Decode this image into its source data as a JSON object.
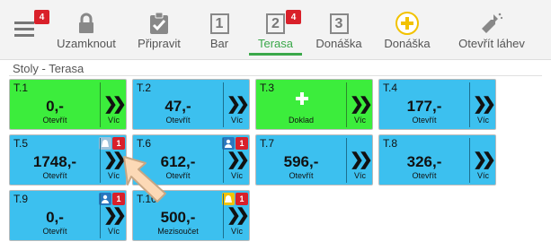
{
  "menu": {
    "badge": "4"
  },
  "toolbar": {
    "lock": "Uzamknout",
    "prepare": "Připravit",
    "bar": "Bar",
    "bar_num": "1",
    "terrace": "Terasa",
    "terrace_num": "2",
    "terrace_badge": "4",
    "delivery": "Donáška",
    "delivery_num": "3",
    "delivery_add": "Donáška",
    "open_bottle": "Otevřít láhev"
  },
  "section": {
    "title": "Stoly - Terasa"
  },
  "colors": {
    "tile_blue": "#3cc0ef",
    "tile_green": "#3ced3c",
    "active": "#3ba84a",
    "badge_red": "#d9202a"
  },
  "tables": [
    {
      "name": "T.1",
      "amount": "0,-",
      "action": "Otevřít",
      "more": "Víc",
      "state": "open"
    },
    {
      "name": "T.2",
      "amount": "47,-",
      "action": "Otevřít",
      "more": "Víc"
    },
    {
      "name": "T.3",
      "action": "Doklad",
      "more": "Víc",
      "icon": "plus-icon",
      "state": "open"
    },
    {
      "name": "T.4",
      "amount": "177,-",
      "action": "Otevřít",
      "more": "Víc"
    },
    {
      "name": "T.5",
      "amount": "1748,-",
      "action": "Otevřít",
      "more": "Víc",
      "indicator": "bell-icon",
      "count": "1"
    },
    {
      "name": "T.6",
      "amount": "612,-",
      "action": "Otevřít",
      "more": "Víc",
      "indicator": "user-icon",
      "count": "1"
    },
    {
      "name": "T.7",
      "amount": "596,-",
      "action": "Otevřít",
      "more": "Víc"
    },
    {
      "name": "T.8",
      "amount": "326,-",
      "action": "Otevřít",
      "more": "Víc"
    },
    {
      "name": "T.9",
      "amount": "0,-",
      "action": "Otevřít",
      "more": "Víc",
      "indicator": "user-icon",
      "count": "1"
    },
    {
      "name": "T.10",
      "amount": "500,-",
      "action": "Mezisoučet",
      "more": "Víc",
      "indicator": "bell-icon",
      "count": "1"
    }
  ]
}
